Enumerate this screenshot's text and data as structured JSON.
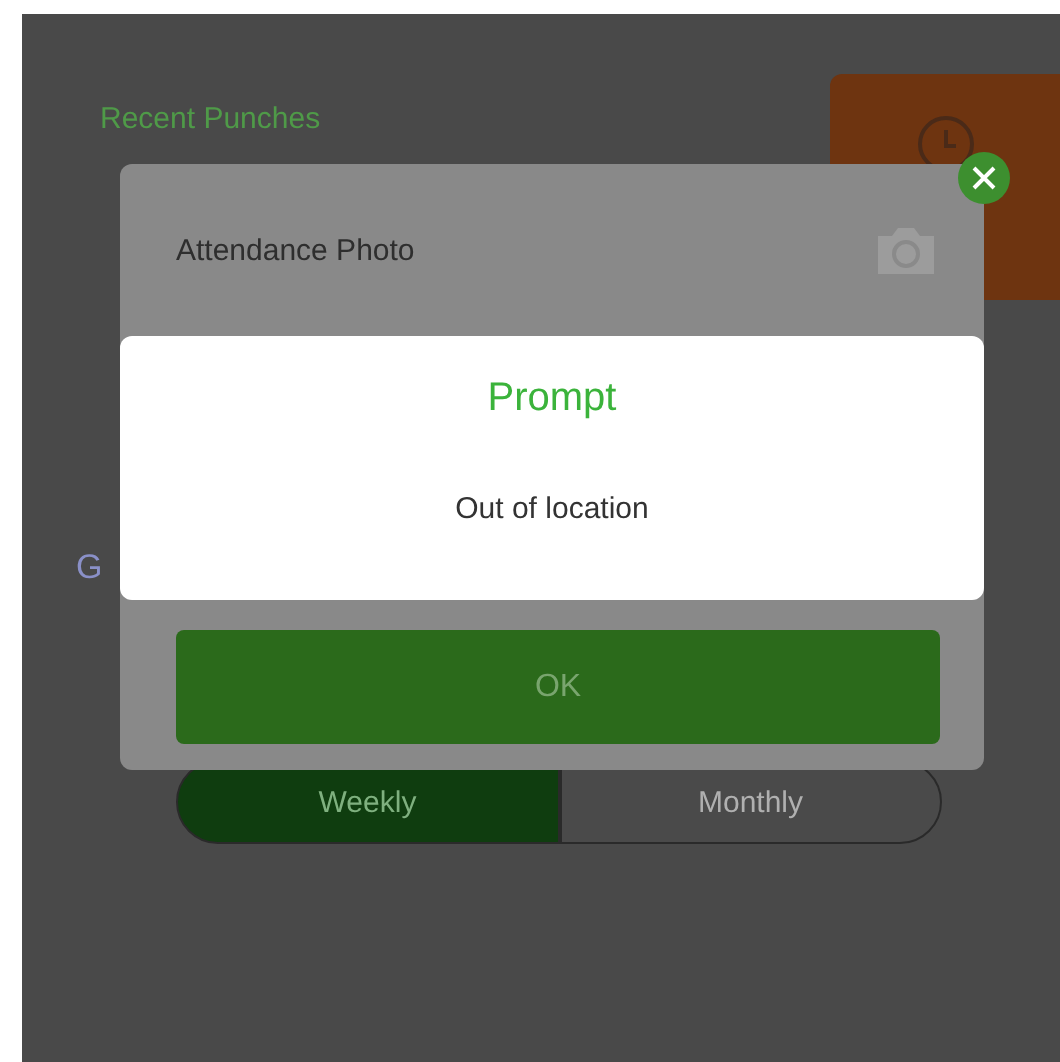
{
  "screen": {
    "heading": "Recent Punches",
    "section_label": "G",
    "period_tabs": [
      {
        "label": "Weekly",
        "selected": true
      },
      {
        "label": "Monthly",
        "selected": false
      }
    ]
  },
  "photo_dialog": {
    "title": "Attendance Photo",
    "ok_button": "OK"
  },
  "prompt": {
    "title": "Prompt",
    "message": "Out of location"
  }
}
